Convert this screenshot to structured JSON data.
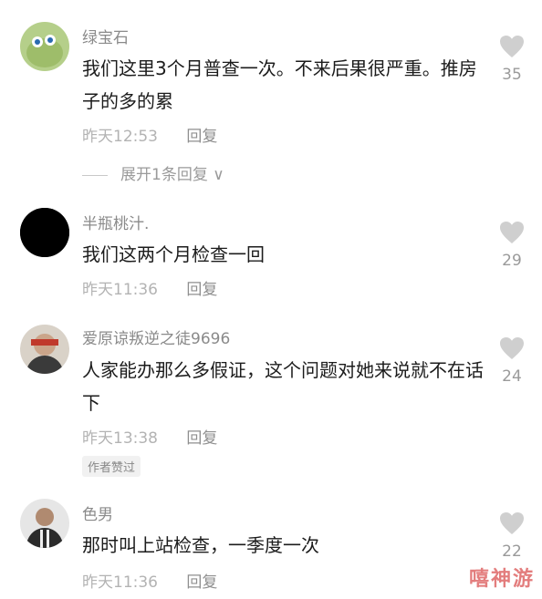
{
  "comments": [
    {
      "username": "绿宝石",
      "text": "我们这里3个月普查一次。不来后果很严重。推房子的多的累",
      "time": "昨天12:53",
      "reply_label": "回复",
      "likes": "35",
      "avatar_color": "#a8c97a",
      "expand_label": "展开1条回复"
    },
    {
      "username": "半瓶桃汁.",
      "text": "我们这两个月检查一回",
      "time": "昨天11:36",
      "reply_label": "回复",
      "likes": "29",
      "avatar_color": "#000000"
    },
    {
      "username": "爱原谅叛逆之徒9696",
      "text": "人家能办那么多假证，这个问题对她来说就不在话下",
      "time": "昨天13:38",
      "reply_label": "回复",
      "likes": "24",
      "avatar_color": "#c0392b",
      "badge": "作者赞过"
    },
    {
      "username": "色男",
      "text": "那时叫上站检查，一季度一次",
      "time": "昨天11:36",
      "reply_label": "回复",
      "likes": "22",
      "avatar_color": "#555555"
    }
  ],
  "watermark": "嘻神游"
}
